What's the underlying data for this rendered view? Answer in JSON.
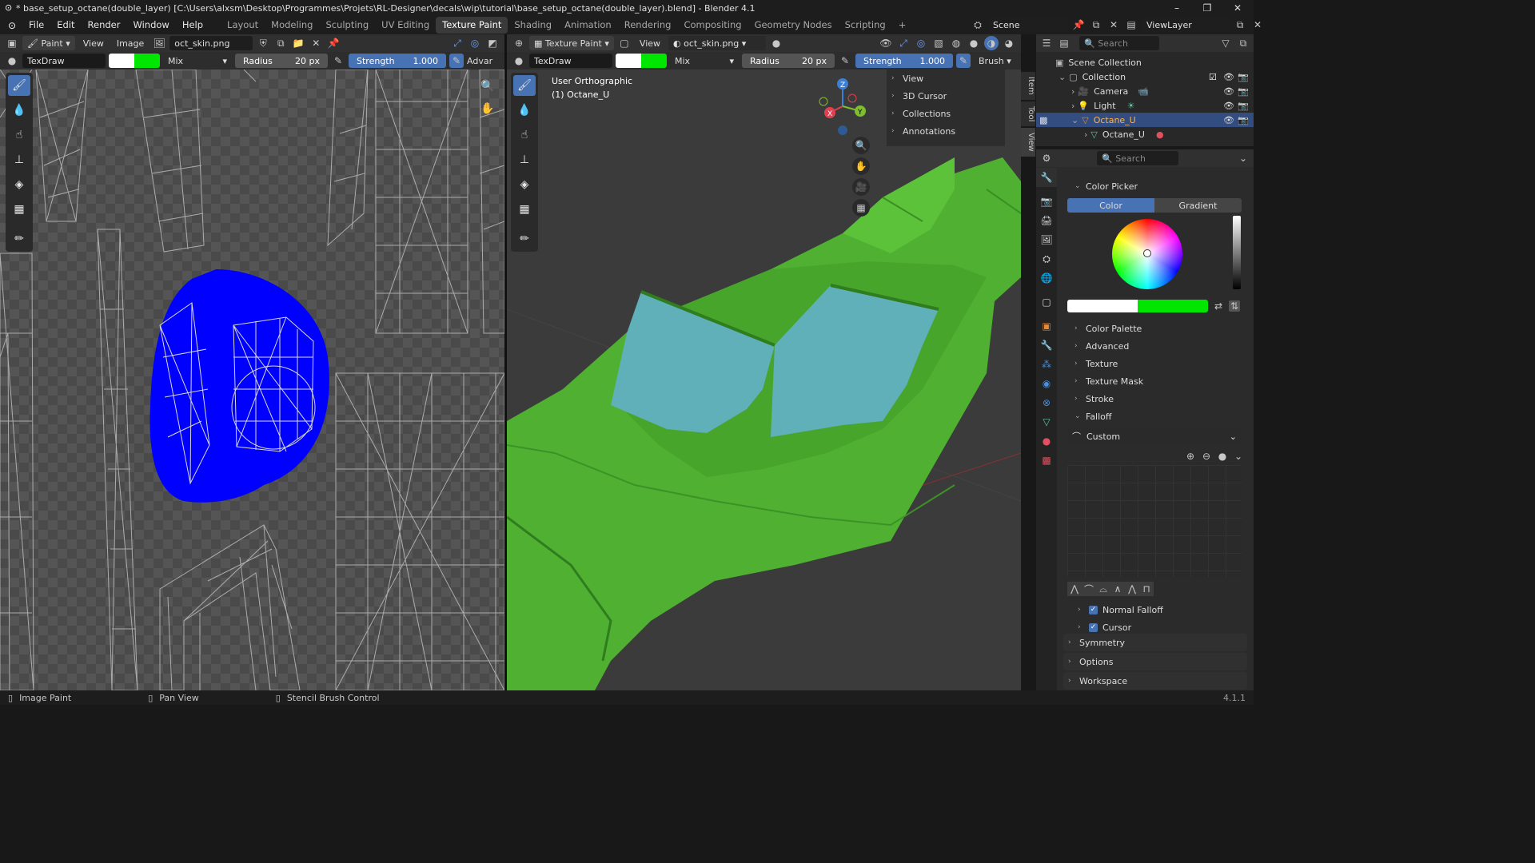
{
  "window": {
    "title": "* base_setup_octane(double_layer) [C:\\Users\\alxsm\\Desktop\\Programmes\\Projets\\RL-Designer\\decals\\wip\\tutorial\\base_setup_octane(double_layer).blend] - Blender 4.1"
  },
  "menu": {
    "items": [
      "File",
      "Edit",
      "Render",
      "Window",
      "Help"
    ],
    "workspaces": [
      "Layout",
      "Modeling",
      "Sculpting",
      "UV Editing",
      "Texture Paint",
      "Shading",
      "Animation",
      "Rendering",
      "Compositing",
      "Geometry Nodes",
      "Scripting"
    ],
    "active_workspace": "Texture Paint",
    "add_workspace": "+",
    "scene": "Scene",
    "view_layer": "ViewLayer"
  },
  "image_editor": {
    "mode": "Paint",
    "view": "View",
    "image_menu": "Image",
    "image_name": "oct_skin.png",
    "brush": "TexDraw",
    "blend": "Mix",
    "radius_label": "Radius",
    "radius_value": "20 px",
    "strength_label": "Strength",
    "strength_value": "1.000",
    "advanced": "Advar"
  },
  "viewport": {
    "mode": "Texture Paint",
    "view": "View",
    "image_name": "oct_skin.png",
    "brush": "TexDraw",
    "blend": "Mix",
    "radius_label": "Radius",
    "radius_value": "20 px",
    "strength_label": "Strength",
    "strength_value": "1.000",
    "brush_menu": "Brush",
    "overlay_title": "User Orthographic",
    "overlay_object": "(1) Octane_U",
    "npanel_items": [
      "View",
      "3D Cursor",
      "Collections",
      "Annotations"
    ],
    "npanel_tabs": [
      "Item",
      "Tool",
      "View"
    ],
    "gizmo": {
      "x": "X",
      "y": "Y",
      "z": "Z"
    }
  },
  "outliner": {
    "search_placeholder": "Search",
    "scene_collection": "Scene Collection",
    "collection": "Collection",
    "items": [
      "Camera",
      "Light",
      "Octane_U"
    ],
    "child": "Octane_U"
  },
  "properties": {
    "search_placeholder": "Search",
    "color_picker": "Color Picker",
    "tab_color": "Color",
    "tab_gradient": "Gradient",
    "sections_collapsed": [
      "Color Palette",
      "Advanced",
      "Texture",
      "Texture Mask",
      "Stroke"
    ],
    "falloff": "Falloff",
    "falloff_preset": "Custom",
    "normal_falloff": "Normal Falloff",
    "cursor": "Cursor",
    "bottom_sections": [
      "Symmetry",
      "Options",
      "Workspace"
    ]
  },
  "status": {
    "left": "Image Paint",
    "middle": "Pan View",
    "right": "Stencil Brush Control",
    "version": "4.1.1"
  },
  "colors": {
    "accent": "#4772b3",
    "primary_color": "#ffffff",
    "secondary_color": "#00e600",
    "car_green": "#52b332",
    "paint_blue": "#0000ff"
  }
}
